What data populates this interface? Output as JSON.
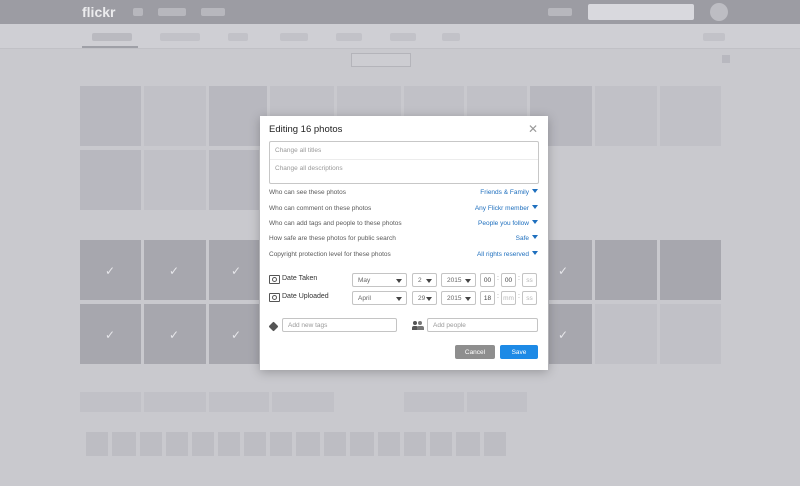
{
  "app": {
    "logo": "flickr"
  },
  "modal": {
    "title": "Editing 16 photos",
    "close_icon": "close-icon",
    "titles_placeholder": "Change all titles",
    "descriptions_placeholder": "Change all descriptions",
    "settings": [
      {
        "label": "Who can see these photos",
        "value": "Friends & Family"
      },
      {
        "label": "Who can comment on these photos",
        "value": "Any Flickr member"
      },
      {
        "label": "Who can add tags and people to these photos",
        "value": "People you follow"
      },
      {
        "label": "How safe are these photos for public search",
        "value": "Safe"
      },
      {
        "label": "Copyright protection level for these photos",
        "value": "All rights reserved"
      }
    ],
    "date_taken": {
      "label": "Date Taken",
      "month": "May",
      "day": "2",
      "year": "2015",
      "hh": "00",
      "mm": "00",
      "ss": "ss"
    },
    "date_uploaded": {
      "label": "Date Uploaded",
      "month": "April",
      "day": "29",
      "year": "2015",
      "hh": "18",
      "mm": "mm",
      "ss": "ss"
    },
    "tags_placeholder": "Add new tags",
    "people_placeholder": "Add people",
    "cancel_label": "Cancel",
    "save_label": "Save"
  },
  "colors": {
    "accent": "#1d8ae6",
    "link": "#1e6fbe",
    "overlay": "#c9c9ce"
  }
}
